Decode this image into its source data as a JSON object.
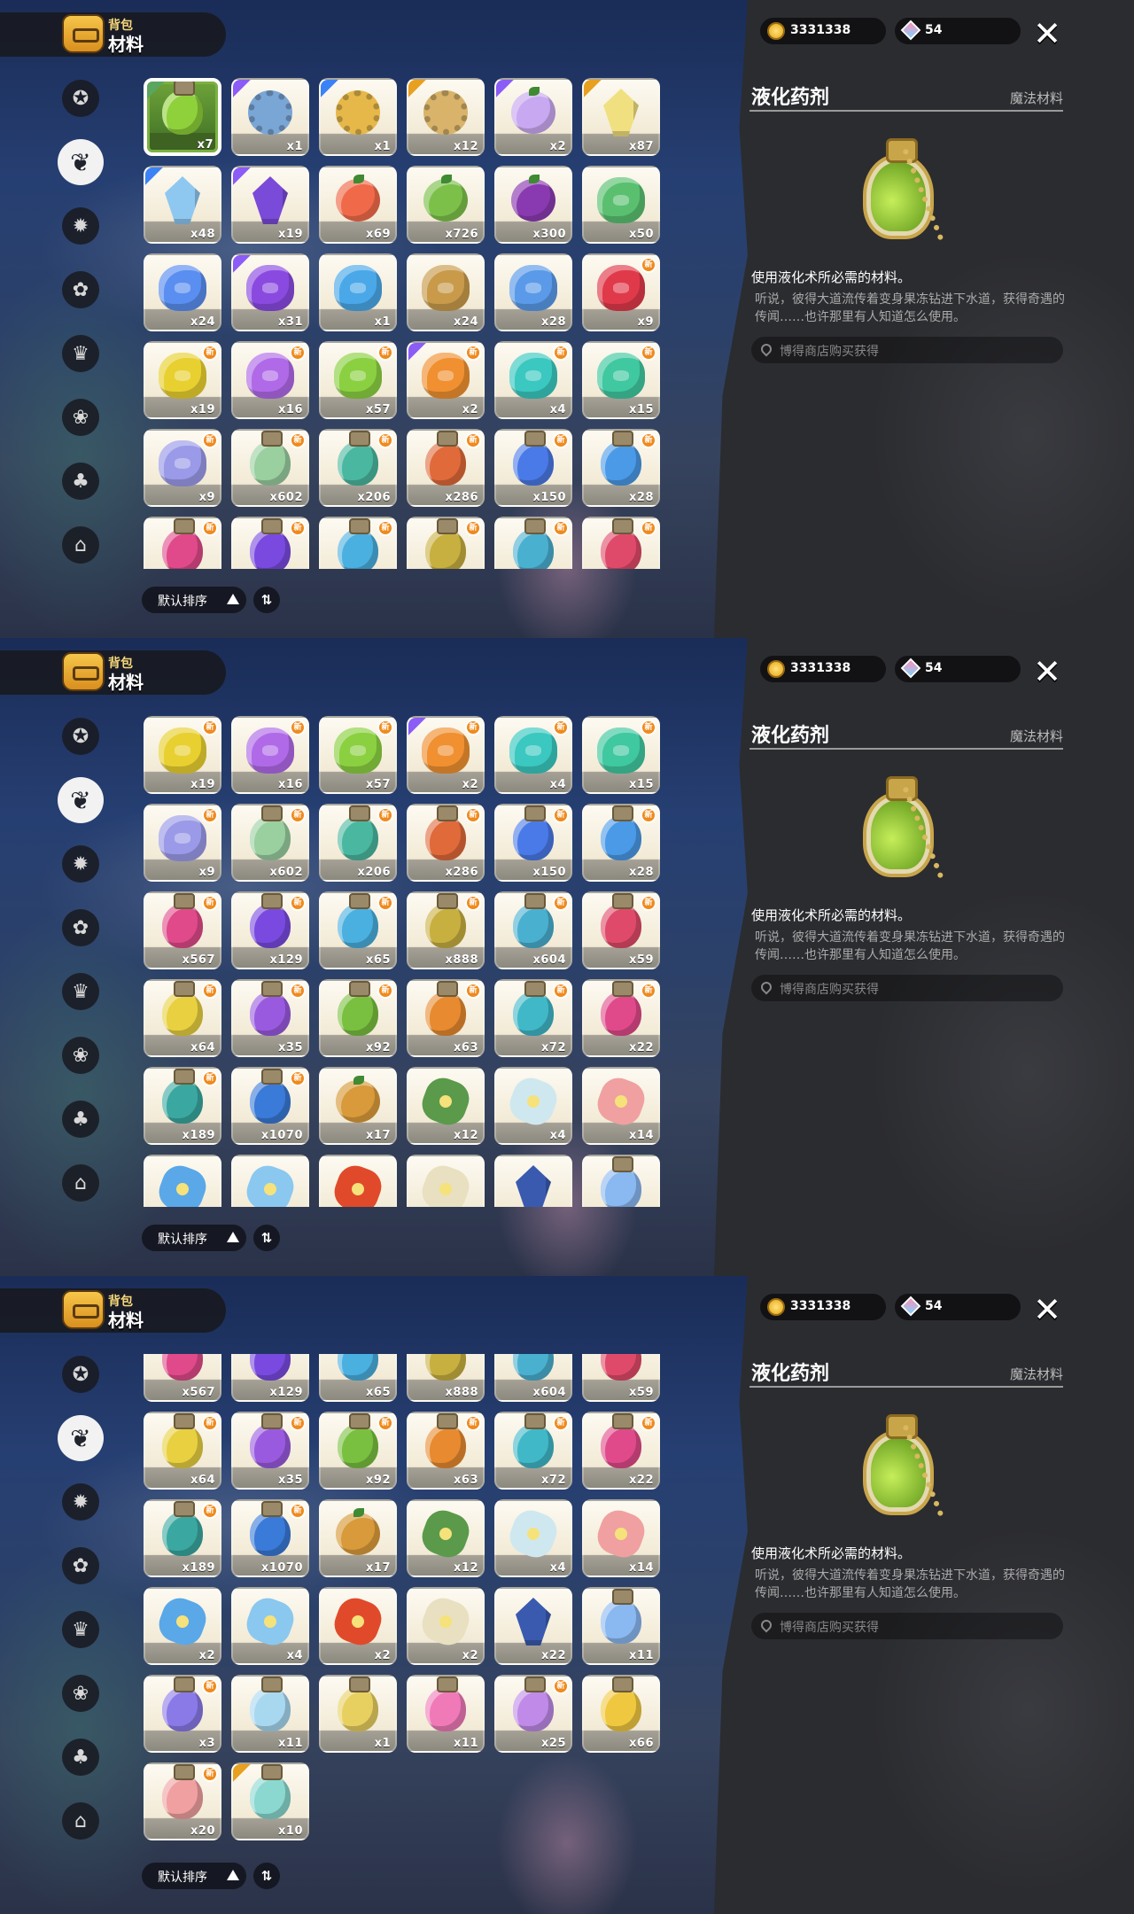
{
  "header": {
    "small": "背包",
    "big": "材料"
  },
  "nav": [
    {
      "icon": "star-badge-icon",
      "glyph": "✪"
    },
    {
      "icon": "leaves-icon",
      "glyph": "❦"
    },
    {
      "icon": "gear-badge-icon",
      "glyph": "✹"
    },
    {
      "icon": "leaf-icon",
      "glyph": "✿"
    },
    {
      "icon": "crown-card-icon",
      "glyph": "♛"
    },
    {
      "icon": "flower-badge-icon",
      "glyph": "❀"
    },
    {
      "icon": "acorn-icon",
      "glyph": "♣"
    },
    {
      "icon": "chest-icon",
      "glyph": "⌂"
    }
  ],
  "active_nav": 1,
  "sort": {
    "label": "默认排序",
    "order_icon": "⇅"
  },
  "currency": {
    "coins": "3331338",
    "gems": "54"
  },
  "detail": {
    "name": "液化药剂",
    "category": "魔法材料",
    "description": "使用液化术所必需的材料。",
    "lore": "听说，彼得大道流传着变身果冻钻进下水道，获得奇遇的传闻……也许那里有人知道怎么使用。",
    "source": "博得商店购买获得"
  },
  "colors": {
    "green": "#8fd13a",
    "purple": "#9b6cf2",
    "gold": "#e8a020",
    "blue": "#4aa0f0"
  },
  "panels": [
    {
      "rows": [
        [
          {
            "k": "bottle",
            "c": "#8fd13a",
            "q": "x7",
            "sel": true,
            "r": "cn"
          },
          {
            "k": "gear",
            "c": "#7aa6d6",
            "q": "x1",
            "r": "cp"
          },
          {
            "k": "gear",
            "c": "#e6b84a",
            "q": "x1",
            "r": "cb"
          },
          {
            "k": "gear",
            "c": "#d9b36a",
            "q": "x12",
            "r": "cg"
          },
          {
            "k": "fruit",
            "c": "#c8a8f0",
            "q": "x2",
            "r": "cp"
          },
          {
            "k": "crystal",
            "c": "#f0e080",
            "q": "x87",
            "r": "cg"
          }
        ],
        [
          {
            "k": "crystal",
            "c": "#8ec8f0",
            "q": "x48",
            "r": "cb"
          },
          {
            "k": "crystal",
            "c": "#7a4ad8",
            "q": "x19",
            "r": "cp"
          },
          {
            "k": "fruit",
            "c": "#f06a4a",
            "q": "x69"
          },
          {
            "k": "fruit",
            "c": "#7cc04a",
            "q": "x726"
          },
          {
            "k": "fruit",
            "c": "#8a3ab0",
            "q": "x300"
          },
          {
            "k": "stone",
            "c": "#5ac070",
            "q": "x50"
          }
        ],
        [
          {
            "k": "stone",
            "c": "#5a8ef0",
            "q": "x24"
          },
          {
            "k": "stone",
            "c": "#8a4ae0",
            "q": "x31",
            "r": "cp"
          },
          {
            "k": "stone",
            "c": "#4aa8e8",
            "q": "x1"
          },
          {
            "k": "stone",
            "c": "#c89a4a",
            "q": "x24"
          },
          {
            "k": "stone",
            "c": "#5a9ae8",
            "q": "x28"
          },
          {
            "k": "stone",
            "c": "#e03a4a",
            "q": "x9",
            "n": true
          }
        ],
        [
          {
            "k": "stone",
            "c": "#e8d030",
            "q": "x19",
            "n": true
          },
          {
            "k": "stone",
            "c": "#b06ae8",
            "q": "x16",
            "n": true
          },
          {
            "k": "stone",
            "c": "#8ad040",
            "q": "x57",
            "n": true
          },
          {
            "k": "stone",
            "c": "#f09030",
            "q": "x2",
            "n": true,
            "r": "cp"
          },
          {
            "k": "stone",
            "c": "#3ac8c0",
            "q": "x4",
            "n": true
          },
          {
            "k": "stone",
            "c": "#40c8a0",
            "q": "x15",
            "n": true
          }
        ],
        [
          {
            "k": "stone",
            "c": "#9a9ae8",
            "q": "x9",
            "n": true
          },
          {
            "k": "bottle",
            "c": "#9acfa0",
            "q": "x602",
            "n": true
          },
          {
            "k": "bottle",
            "c": "#4ab8a0",
            "q": "x206",
            "n": true
          },
          {
            "k": "bottle",
            "c": "#e06a3a",
            "q": "x286",
            "n": true
          },
          {
            "k": "bottle",
            "c": "#4a7ae8",
            "q": "x150",
            "n": true
          },
          {
            "k": "bottle",
            "c": "#4a9ae8",
            "q": "x28",
            "n": true
          }
        ],
        [
          {
            "k": "bottle",
            "c": "#e04a8a",
            "q": "",
            "n": true
          },
          {
            "k": "bottle",
            "c": "#7a4ae0",
            "q": "",
            "n": true
          },
          {
            "k": "bottle",
            "c": "#4ab0e0",
            "q": "",
            "n": true
          },
          {
            "k": "bottle",
            "c": "#c8b040",
            "q": "",
            "n": true
          },
          {
            "k": "bottle",
            "c": "#4ab0d0",
            "q": "",
            "n": true
          },
          {
            "k": "bottle",
            "c": "#e04a6a",
            "q": "",
            "n": true
          }
        ]
      ]
    },
    {
      "rows": [
        [
          {
            "k": "stone",
            "c": "#e8d030",
            "q": "x19",
            "n": true
          },
          {
            "k": "stone",
            "c": "#b06ae8",
            "q": "x16",
            "n": true
          },
          {
            "k": "stone",
            "c": "#8ad040",
            "q": "x57",
            "n": true
          },
          {
            "k": "stone",
            "c": "#f09030",
            "q": "x2",
            "n": true,
            "r": "cp"
          },
          {
            "k": "stone",
            "c": "#3ac8c0",
            "q": "x4",
            "n": true
          },
          {
            "k": "stone",
            "c": "#40c8a0",
            "q": "x15",
            "n": true
          }
        ],
        [
          {
            "k": "stone",
            "c": "#9a9ae8",
            "q": "x9",
            "n": true
          },
          {
            "k": "bottle",
            "c": "#9acfa0",
            "q": "x602",
            "n": true
          },
          {
            "k": "bottle",
            "c": "#4ab8a0",
            "q": "x206",
            "n": true
          },
          {
            "k": "bottle",
            "c": "#e06a3a",
            "q": "x286",
            "n": true
          },
          {
            "k": "bottle",
            "c": "#4a7ae8",
            "q": "x150",
            "n": true
          },
          {
            "k": "bottle",
            "c": "#4a9ae8",
            "q": "x28",
            "n": true
          }
        ],
        [
          {
            "k": "bottle",
            "c": "#e04a8a",
            "q": "x567",
            "n": true
          },
          {
            "k": "bottle",
            "c": "#7a4ae0",
            "q": "x129",
            "n": true
          },
          {
            "k": "bottle",
            "c": "#4ab0e0",
            "q": "x65",
            "n": true
          },
          {
            "k": "bottle",
            "c": "#c8b040",
            "q": "x888",
            "n": true
          },
          {
            "k": "bottle",
            "c": "#4ab0d0",
            "q": "x604",
            "n": true
          },
          {
            "k": "bottle",
            "c": "#e04a6a",
            "q": "x59",
            "n": true
          }
        ],
        [
          {
            "k": "bottle",
            "c": "#e8d040",
            "q": "x64",
            "n": true
          },
          {
            "k": "bottle",
            "c": "#9a5ae0",
            "q": "x35",
            "n": true
          },
          {
            "k": "bottle",
            "c": "#7ac040",
            "q": "x92",
            "n": true
          },
          {
            "k": "bottle",
            "c": "#e88a30",
            "q": "x63",
            "n": true
          },
          {
            "k": "bottle",
            "c": "#40b8c8",
            "q": "x72",
            "n": true
          },
          {
            "k": "bottle",
            "c": "#e04a8a",
            "q": "x22",
            "n": true
          }
        ],
        [
          {
            "k": "bottle",
            "c": "#3aa8a0",
            "q": "x189",
            "n": true
          },
          {
            "k": "bottle",
            "c": "#3a7ad8",
            "q": "x1070",
            "n": true
          },
          {
            "k": "fruit",
            "c": "#d89a3a",
            "q": "x17"
          },
          {
            "k": "flower",
            "c": "#5a9a4a",
            "q": "x12"
          },
          {
            "k": "flower",
            "c": "#cfe8f0",
            "q": "x4"
          },
          {
            "k": "flower",
            "c": "#f0a0a0",
            "q": "x14"
          }
        ],
        [
          {
            "k": "flower",
            "c": "#5aa8e8",
            "q": ""
          },
          {
            "k": "flower",
            "c": "#8ac8f0",
            "q": ""
          },
          {
            "k": "flower",
            "c": "#e04a2a",
            "q": ""
          },
          {
            "k": "flower",
            "c": "#e8e0c0",
            "q": ""
          },
          {
            "k": "crystal",
            "c": "#3a5ab0",
            "q": ""
          },
          {
            "k": "bottle",
            "c": "#8ab8f0",
            "q": ""
          }
        ]
      ]
    },
    {
      "rows": [
        [
          {
            "k": "bottle",
            "c": "#e04a8a",
            "q": "x567",
            "n": true
          },
          {
            "k": "bottle",
            "c": "#7a4ae0",
            "q": "x129",
            "n": true
          },
          {
            "k": "bottle",
            "c": "#4ab0e0",
            "q": "x65",
            "n": true
          },
          {
            "k": "bottle",
            "c": "#c8b040",
            "q": "x888",
            "n": true
          },
          {
            "k": "bottle",
            "c": "#4ab0d0",
            "q": "x604",
            "n": true
          },
          {
            "k": "bottle",
            "c": "#e04a6a",
            "q": "x59",
            "n": true
          }
        ],
        [
          {
            "k": "bottle",
            "c": "#e8d040",
            "q": "x64",
            "n": true
          },
          {
            "k": "bottle",
            "c": "#9a5ae0",
            "q": "x35",
            "n": true
          },
          {
            "k": "bottle",
            "c": "#7ac040",
            "q": "x92",
            "n": true
          },
          {
            "k": "bottle",
            "c": "#e88a30",
            "q": "x63",
            "n": true
          },
          {
            "k": "bottle",
            "c": "#40b8c8",
            "q": "x72",
            "n": true
          },
          {
            "k": "bottle",
            "c": "#e04a8a",
            "q": "x22",
            "n": true
          }
        ],
        [
          {
            "k": "bottle",
            "c": "#3aa8a0",
            "q": "x189",
            "n": true
          },
          {
            "k": "bottle",
            "c": "#3a7ad8",
            "q": "x1070",
            "n": true
          },
          {
            "k": "fruit",
            "c": "#d89a3a",
            "q": "x17"
          },
          {
            "k": "flower",
            "c": "#5a9a4a",
            "q": "x12"
          },
          {
            "k": "flower",
            "c": "#cfe8f0",
            "q": "x4"
          },
          {
            "k": "flower",
            "c": "#f0a0a0",
            "q": "x14"
          }
        ],
        [
          {
            "k": "flower",
            "c": "#5aa8e8",
            "q": "x2"
          },
          {
            "k": "flower",
            "c": "#8ac8f0",
            "q": "x4"
          },
          {
            "k": "flower",
            "c": "#e04a2a",
            "q": "x2"
          },
          {
            "k": "flower",
            "c": "#e8e0c0",
            "q": "x2"
          },
          {
            "k": "crystal",
            "c": "#3a5ab0",
            "q": "x22"
          },
          {
            "k": "bottle",
            "c": "#8ab8f0",
            "q": "x11"
          }
        ],
        [
          {
            "k": "bottle",
            "c": "#8a7ae8",
            "q": "x3",
            "n": true
          },
          {
            "k": "bottle",
            "c": "#a8d8f0",
            "q": "x11"
          },
          {
            "k": "bottle",
            "c": "#e8d060",
            "q": "x1"
          },
          {
            "k": "bottle",
            "c": "#f07ab8",
            "q": "x11"
          },
          {
            "k": "bottle",
            "c": "#c08ae8",
            "q": "x25",
            "n": true
          },
          {
            "k": "bottle",
            "c": "#f0c840",
            "q": "x66"
          }
        ],
        [
          {
            "k": "bottle",
            "c": "#f0a0a0",
            "q": "x20",
            "n": true
          },
          {
            "k": "bottle",
            "c": "#8ad8d0",
            "q": "x10",
            "r": "cg"
          }
        ]
      ],
      "offset": -34
    }
  ]
}
